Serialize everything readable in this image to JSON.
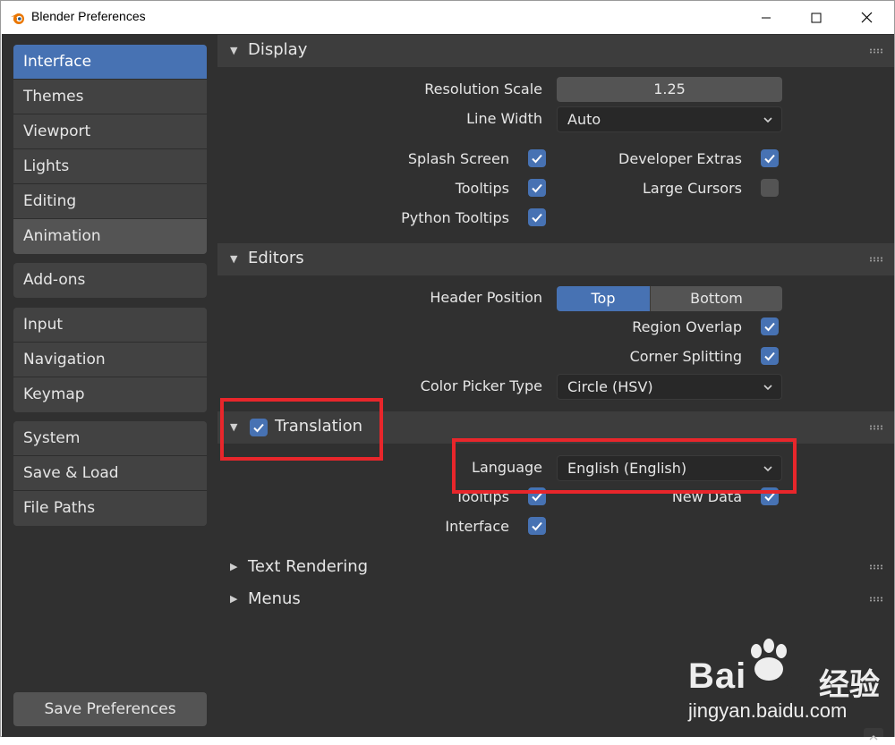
{
  "window": {
    "title": "Blender Preferences",
    "minimize_glyph": "—",
    "maximize_glyph": "☐",
    "close_glyph": "✕"
  },
  "sidebar": {
    "groups": [
      {
        "items": [
          {
            "label": "Interface",
            "active": true
          },
          {
            "label": "Themes"
          },
          {
            "label": "Viewport"
          },
          {
            "label": "Lights"
          },
          {
            "label": "Editing"
          },
          {
            "label": "Animation"
          }
        ]
      },
      {
        "items": [
          {
            "label": "Add-ons"
          }
        ]
      },
      {
        "items": [
          {
            "label": "Input"
          },
          {
            "label": "Navigation"
          },
          {
            "label": "Keymap"
          }
        ]
      },
      {
        "items": [
          {
            "label": "System"
          },
          {
            "label": "Save & Load"
          },
          {
            "label": "File Paths"
          }
        ]
      }
    ],
    "save_button": "Save Preferences"
  },
  "display": {
    "title": "Display",
    "resolution_scale_label": "Resolution Scale",
    "resolution_scale_value": "1.25",
    "line_width_label": "Line Width",
    "line_width_value": "Auto",
    "splash_screen_label": "Splash Screen",
    "splash_screen_checked": true,
    "tooltips_label": "Tooltips",
    "tooltips_checked": true,
    "python_tooltips_label": "Python Tooltips",
    "python_tooltips_checked": true,
    "developer_extras_label": "Developer Extras",
    "developer_extras_checked": true,
    "large_cursors_label": "Large Cursors",
    "large_cursors_checked": false
  },
  "editors": {
    "title": "Editors",
    "header_position_label": "Header Position",
    "header_position_options": [
      "Top",
      "Bottom"
    ],
    "header_position_selected": "Top",
    "region_overlap_label": "Region Overlap",
    "region_overlap_checked": true,
    "corner_splitting_label": "Corner Splitting",
    "corner_splitting_checked": true,
    "color_picker_type_label": "Color Picker Type",
    "color_picker_type_value": "Circle (HSV)"
  },
  "translation": {
    "title": "Translation",
    "enabled": true,
    "language_label": "Language",
    "language_value": "English (English)",
    "tooltips_label": "Tooltips",
    "tooltips_checked": true,
    "new_data_label": "New Data",
    "new_data_checked": true,
    "interface_label": "Interface",
    "interface_checked": true
  },
  "collapsed_panels": [
    "Text Rendering",
    "Menus"
  ],
  "watermark": {
    "brand": "Bai",
    "brand2": "du",
    "cn": "经验",
    "url": "jingyan.baidu.com"
  },
  "colors": {
    "accent": "#4772b3",
    "highlight_box": "#e8262b",
    "background": "#303030",
    "panel_header": "#3d3d3d"
  }
}
